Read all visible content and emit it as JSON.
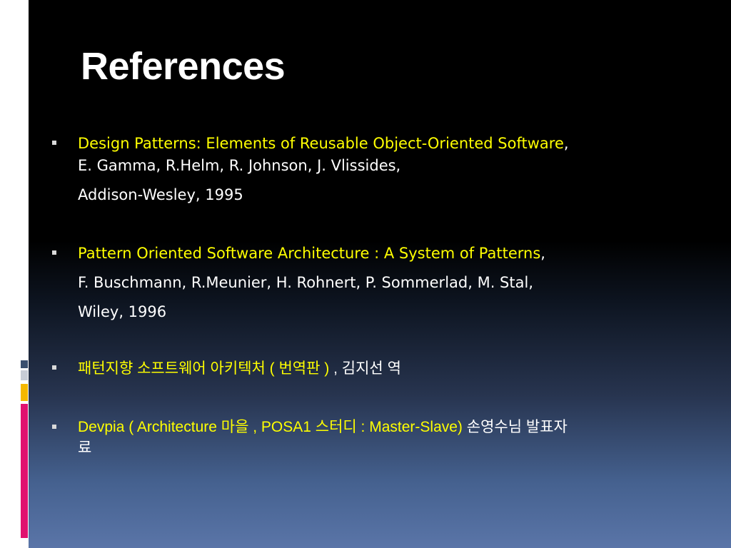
{
  "slide": {
    "title": "References",
    "references": [
      {
        "title": "Design Patterns: Elements of Reusable Object-Oriented Software",
        "line1_suffix": ",",
        "line2": "E. Gamma, R.Helm, R. Johnson, J. Vlissides,",
        "line3": "Addison-Wesley, 1995"
      },
      {
        "title": "Pattern Oriented Software Architecture : A System of Patterns",
        "line1_suffix": ",",
        "line2": "F. Buschmann, R.Meunier, H. Rohnert, P. Sommerlad, M. Stal,",
        "line3": "Wiley, 1996"
      },
      {
        "title": "패턴지향 소프트웨어 아키텍처 ( 번역판 )",
        "suffix": " , 김지선 역"
      },
      {
        "title": "Devpia ( Architecture 마을 , POSA1 스터디 : Master-Slave)",
        "suffix": " 손영수님 발표자",
        "line2": "료"
      }
    ]
  },
  "colors": {
    "background": "#000000",
    "gradient_bottom": "#5a75a8",
    "title_text": "#ffffff",
    "highlight_text": "#ffff00",
    "deco_gray": "#3a4f6e",
    "deco_orange": "#f5b800",
    "deco_pink": "#e0116f"
  }
}
